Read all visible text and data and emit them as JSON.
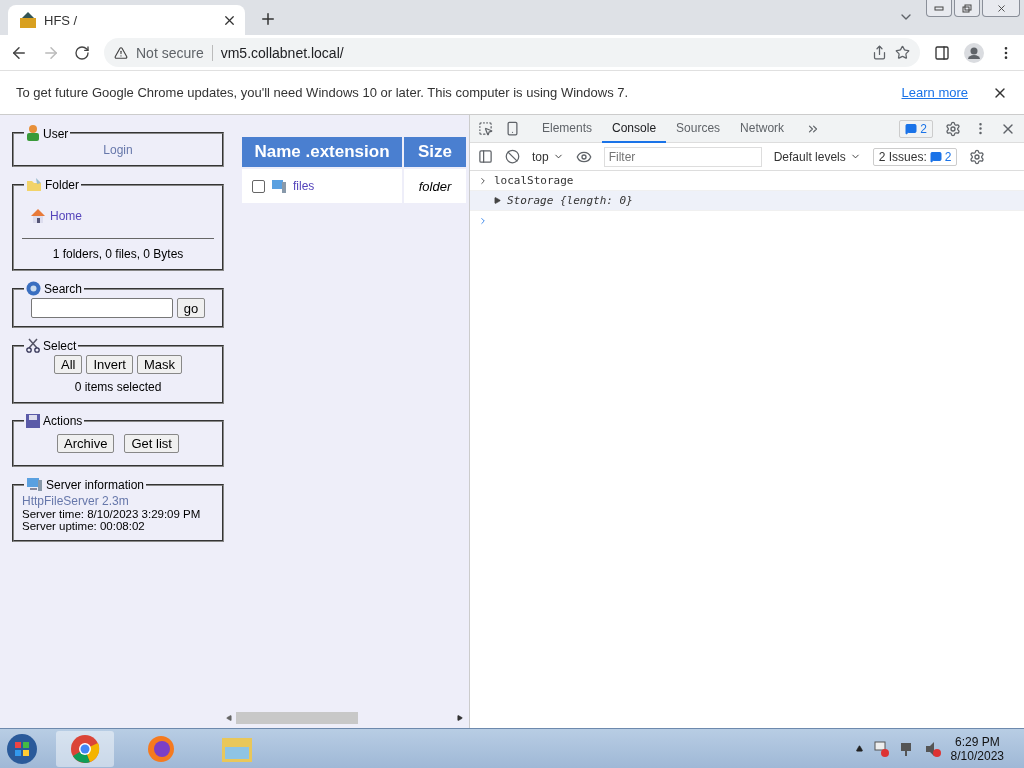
{
  "browser": {
    "tab_title": "HFS /",
    "security": "Not secure",
    "url": "vm5.collabnet.local/"
  },
  "infobar": {
    "message": "To get future Google Chrome updates, you'll need Windows 10 or later. This computer is using Windows 7.",
    "link": "Learn more"
  },
  "sidebar": [
    {
      "kind": "user",
      "title": "User",
      "link": "Login"
    },
    {
      "kind": "folder",
      "title": "Folder",
      "link": "Home",
      "summary": "1 folders, 0 files, 0 Bytes"
    },
    {
      "kind": "search",
      "title": "Search",
      "button": "go"
    },
    {
      "kind": "select",
      "title": "Select",
      "buttons": [
        "All",
        "Invert",
        "Mask"
      ],
      "summary": "0 items selected"
    },
    {
      "kind": "actions",
      "title": "Actions",
      "buttons": [
        "Archive",
        "Get list"
      ]
    },
    {
      "kind": "server",
      "title": "Server information",
      "link": "HttpFileServer 2.3m",
      "lines": [
        "Server time: 8/10/2023 3:29:09 PM",
        "Server uptime: 00:08:02"
      ]
    }
  ],
  "file_table": {
    "columns": [
      "Name .extension",
      "Size"
    ],
    "rows": [
      {
        "name": "files",
        "size": "folder",
        "checked": false
      }
    ]
  },
  "devtools": {
    "tabs": [
      {
        "label": "Elements",
        "selected": false
      },
      {
        "label": "Console",
        "selected": true
      },
      {
        "label": "Sources",
        "selected": false
      },
      {
        "label": "Network",
        "selected": false
      }
    ],
    "messages_badge": "2",
    "context": "top",
    "filter_placeholder": "Filter",
    "levels": "Default levels",
    "issues_label": "2 Issues:",
    "issues_count": "2",
    "console": [
      {
        "kind": "input",
        "text": "localStorage"
      },
      {
        "kind": "output",
        "text": "Storage {length: 0}",
        "expanded": false
      },
      {
        "kind": "prompt"
      }
    ]
  },
  "taskbar": {
    "time": "6:29 PM",
    "date": "8/10/2023"
  }
}
